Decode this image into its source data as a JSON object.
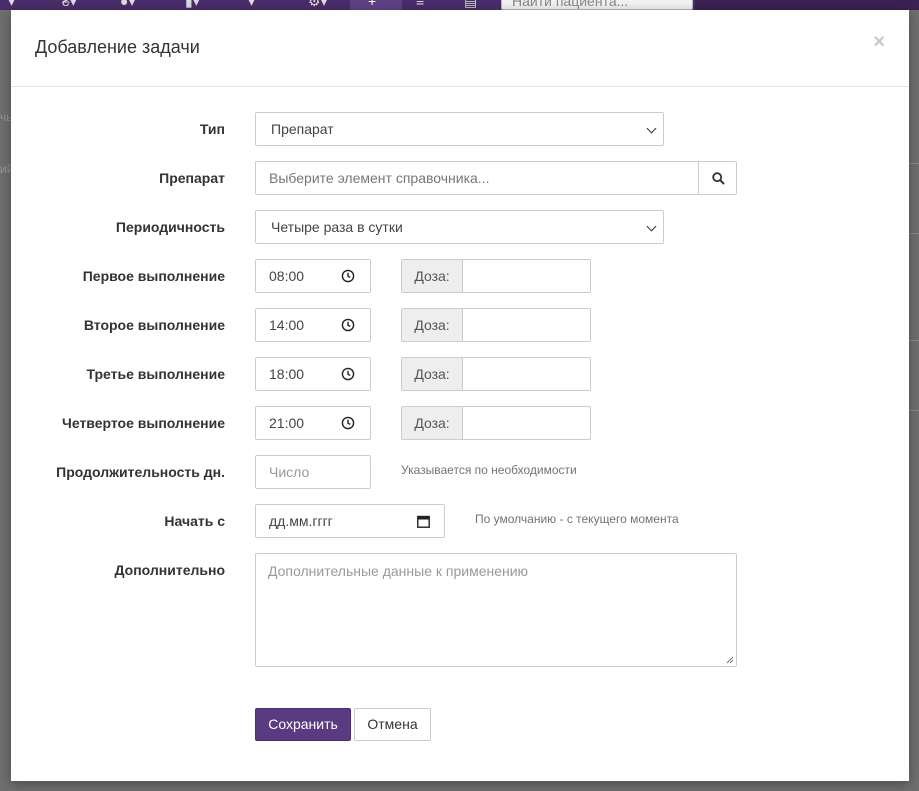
{
  "background": {
    "search_placeholder": "Найти пациента...",
    "left_fragments": [
      "чь",
      "ий"
    ]
  },
  "modal": {
    "title": "Добавление задачи",
    "close_symbol": "×"
  },
  "form": {
    "type": {
      "label": "Тип",
      "value": "Препарат"
    },
    "drug": {
      "label": "Препарат",
      "placeholder": "Выберите элемент справочника..."
    },
    "frequency": {
      "label": "Периодичность",
      "value": "Четыре раза в сутки"
    },
    "doses": [
      {
        "label": "Первое выполнение",
        "time": "08:00",
        "dose_label": "Доза:",
        "dose_value": ""
      },
      {
        "label": "Второе выполнение",
        "time": "14:00",
        "dose_label": "Доза:",
        "dose_value": ""
      },
      {
        "label": "Третье выполнение",
        "time": "18:00",
        "dose_label": "Доза:",
        "dose_value": ""
      },
      {
        "label": "Четвертое выполнение",
        "time": "21:00",
        "dose_label": "Доза:",
        "dose_value": ""
      }
    ],
    "duration": {
      "label": "Продолжительность дн.",
      "placeholder": "Число",
      "help": "Указывается по необходимости"
    },
    "start": {
      "label": "Начать с",
      "placeholder": "дд.мм.гггг",
      "help": "По умолчанию - с текущего момента"
    },
    "extra": {
      "label": "Дополнительно",
      "placeholder": "Дополнительные данные к применению"
    }
  },
  "buttons": {
    "save": "Сохранить",
    "cancel": "Отмена"
  },
  "colors": {
    "primary": "#5a3b82",
    "topbar": "#4a2d6a"
  }
}
